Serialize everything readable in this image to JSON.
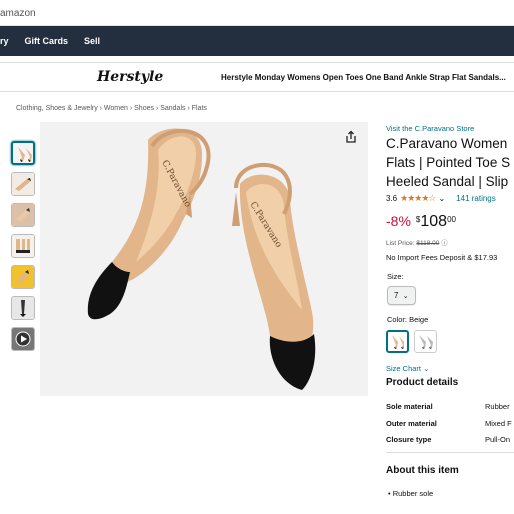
{
  "url_fragment": "amazon",
  "navbar": {
    "items": [
      "ry",
      "Gift Cards",
      "Sell"
    ]
  },
  "brand_strip": {
    "logo": "Herstyle",
    "title": "Herstyle Monday Womens Open Toes One Band Ankle Strap Flat Sandals..."
  },
  "breadcrumb": "Clothing, Shoes & Jewelry › Women › Shoes › Sandals › Flats",
  "gallery": {
    "thumb_count": 7,
    "active_index": 0,
    "thumb_icons": [
      "shoe-thumb-icon",
      "shoe-thumb-icon",
      "shoe-thumb-icon",
      "shoe-thumb-icon",
      "shoe-thumb-icon",
      "shoe-thumb-icon",
      "video-thumb-icon"
    ],
    "main_image": "beige-slingback-pointed-toe-heels-image",
    "shoe_brand_print": "C.Paravano"
  },
  "product": {
    "store_link": "Visit the C.Paravano Store",
    "title_lines": [
      "C.Paravano Women",
      "Flats | Pointed Toe S",
      "Heeled Sandal | Slip"
    ],
    "rating_value": "3.6",
    "stars": "★★★★☆",
    "ratings_text": "141 ratings",
    "discount": "-8%",
    "currency": "$",
    "price_whole": "108",
    "price_fraction": "00",
    "list_price_label": "List Price:",
    "list_price_value": "$118.00",
    "import_fees": "No Import Fees Deposit & $17.93",
    "size_label": "Size:",
    "size_value": "7",
    "color_label": "Color: Beige",
    "size_chart": "Size Chart",
    "details_heading": "Product details",
    "details": [
      {
        "key": "Sole material",
        "value": "Rubber"
      },
      {
        "key": "Outer material",
        "value": "Mixed F"
      },
      {
        "key": "Closure type",
        "value": "Pull-On"
      }
    ],
    "about_heading": "About this item",
    "bullets": [
      "Rubber sole"
    ]
  },
  "colors": {
    "navbar_bg": "#232f3e",
    "link": "#007185",
    "discount": "#cc0c39",
    "star": "#de7921",
    "shoe_beige": "#e2b58a",
    "shoe_toe": "#151515"
  }
}
